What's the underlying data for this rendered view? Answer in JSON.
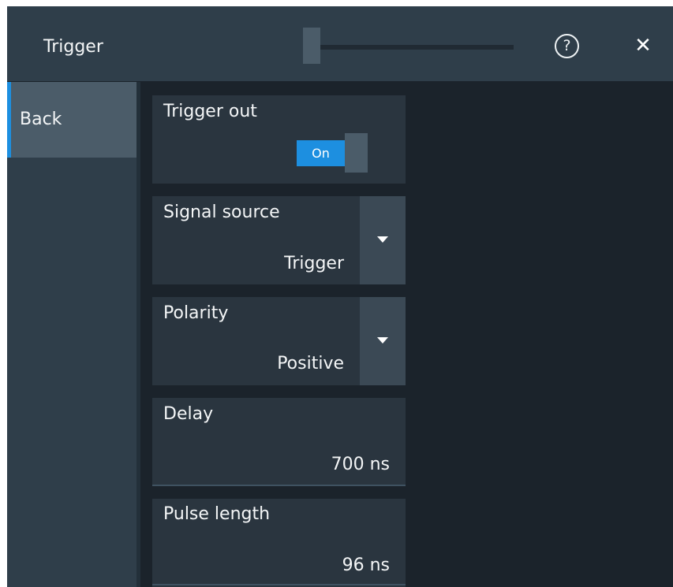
{
  "dialog": {
    "title": "Trigger",
    "help_symbol": "?",
    "close_symbol": "✕",
    "help_icon": "question-circle-icon",
    "close_icon": "close-icon"
  },
  "sidebar": {
    "items": [
      {
        "label": "Back",
        "selected": true
      }
    ]
  },
  "panels": {
    "trigger_out": {
      "label": "Trigger out",
      "toggle_label": "On",
      "toggle_on": true
    },
    "signal_source": {
      "label": "Signal source",
      "value": "Trigger"
    },
    "polarity": {
      "label": "Polarity",
      "value": "Positive"
    },
    "delay": {
      "label": "Delay",
      "value": "700 ns"
    },
    "pulse_length": {
      "label": "Pulse length",
      "value": "96 ns"
    }
  },
  "colors": {
    "accent": "#1d8fe0",
    "background": "#1b232b",
    "panel": "#2a353f",
    "titlebar": "#2f3e4a"
  }
}
